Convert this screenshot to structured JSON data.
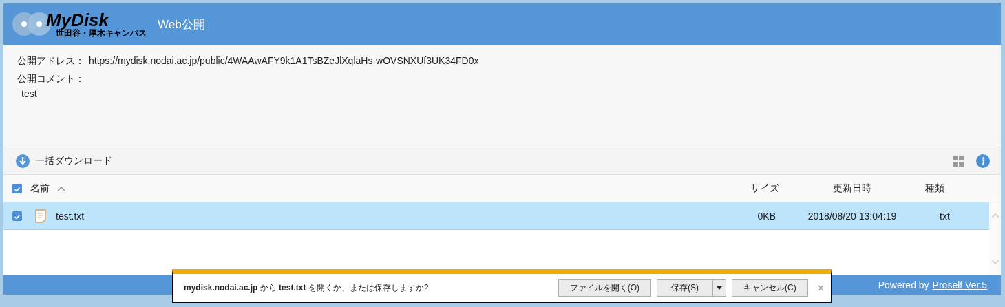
{
  "header": {
    "logo_title": "MyDisk",
    "logo_subtitle": "世田谷・厚木キャンパス",
    "title": "Web公開"
  },
  "info": {
    "address_label": "公開アドレス：",
    "address": "https://mydisk.nodai.ac.jp/public/4WAAwAFY9k1A1TsBZeJlXqlaHs-wOVSNXUf3UK34FD0x",
    "comment_label": "公開コメント：",
    "comment": "test"
  },
  "toolbar": {
    "download_label": "一括ダウンロード"
  },
  "table": {
    "select_all_checked": true,
    "columns": [
      {
        "label": "名前",
        "kind": "name",
        "sorted": true
      },
      {
        "label": "サイズ",
        "kind": "size",
        "sorted": false
      },
      {
        "label": "更新日時",
        "kind": "date",
        "sorted": false
      },
      {
        "label": "種類",
        "kind": "type",
        "sorted": false
      }
    ],
    "rows": [
      {
        "name": "test.txt",
        "size": "0KB",
        "modified": "2018/08/20 13:04:19",
        "type": "txt",
        "checked": true,
        "selected": true
      }
    ]
  },
  "footer": {
    "prefix": "Powered by",
    "link": "Proself Ver.5"
  },
  "download_bar": {
    "message": "**mydisk.nodai.ac.jp** から **test.txt** を開くか、または保存しますか?",
    "buttons": [
      {
        "label": "ファイルを開く(O)",
        "kind": "plain"
      },
      {
        "label": "保存(S)",
        "kind": "split"
      },
      {
        "label": "キャンセル(C)",
        "kind": "plain"
      }
    ],
    "close": "×"
  }
}
